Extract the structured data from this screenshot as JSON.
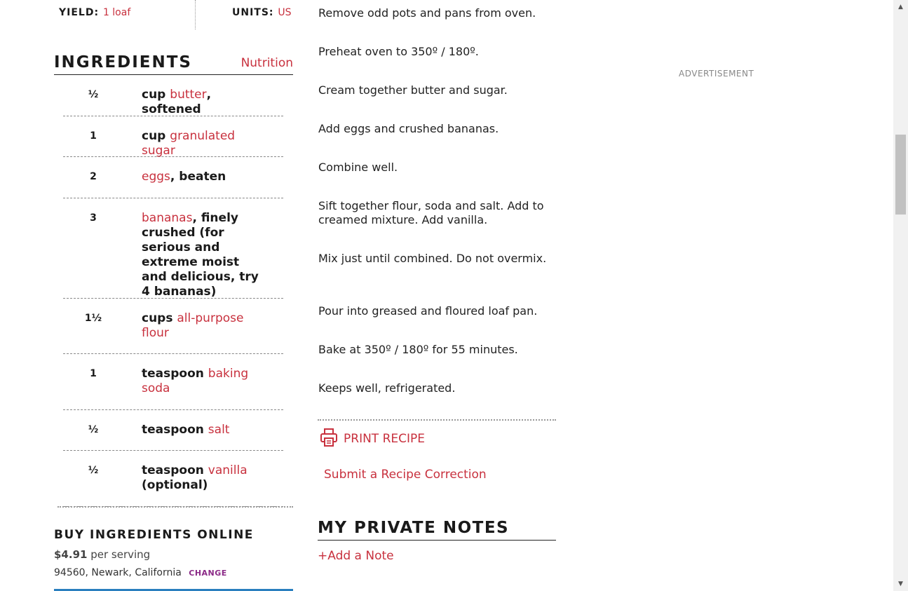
{
  "yield": {
    "label": "YIELD:",
    "value": "1 loaf"
  },
  "units": {
    "label": "UNITS:",
    "value": "US"
  },
  "ingredients": {
    "title": "INGREDIENTS",
    "nutrition_link": "Nutrition",
    "items": [
      {
        "qty": "½",
        "parts": [
          {
            "t": "cup "
          },
          {
            "t": "butter",
            "link": true
          },
          {
            "t": ", softened"
          }
        ]
      },
      {
        "qty": "1",
        "parts": [
          {
            "t": "cup "
          },
          {
            "t": "granulated sugar",
            "link": true
          }
        ]
      },
      {
        "qty": "2",
        "parts": [
          {
            "t": "eggs",
            "link": true
          },
          {
            "t": ", beaten"
          }
        ]
      },
      {
        "qty": "3",
        "parts": [
          {
            "t": "bananas",
            "link": true
          },
          {
            "t": ", finely crushed (for serious and extreme moist and delicious, try 4 bananas)"
          }
        ]
      },
      {
        "qty": "1½",
        "parts": [
          {
            "t": "cups "
          },
          {
            "t": "all-purpose flour",
            "link": true
          }
        ]
      },
      {
        "qty": "1",
        "parts": [
          {
            "t": "teaspoon "
          },
          {
            "t": "baking soda",
            "link": true
          }
        ]
      },
      {
        "qty": "½",
        "parts": [
          {
            "t": "teaspoon "
          },
          {
            "t": "salt",
            "link": true
          }
        ]
      },
      {
        "qty": "½",
        "parts": [
          {
            "t": "teaspoon "
          },
          {
            "t": "vanilla",
            "link": true
          },
          {
            "t": " (optional)"
          }
        ]
      }
    ]
  },
  "buy": {
    "title": "BUY INGREDIENTS ONLINE",
    "price": "$4.91",
    "per_serving": "per serving",
    "location": "94560, Newark, California",
    "change": "CHANGE"
  },
  "steps": [
    "Remove odd pots and pans from oven.",
    "Preheat oven to 350º / 180º.",
    "Cream together butter and sugar.",
    "Add eggs and crushed bananas.",
    "Combine well.",
    "Sift together flour, soda and salt. Add to creamed mixture. Add vanilla.",
    "Mix just until combined. Do not overmix.",
    "Pour into greased and floured loaf pan.",
    "Bake at 350º / 180º for 55 minutes.",
    "Keeps well, refrigerated."
  ],
  "actions": {
    "print_label": "PRINT RECIPE",
    "print_icon": "printer-icon",
    "correction_label": "Submit a Recipe Correction"
  },
  "notes": {
    "title": "MY PRIVATE NOTES",
    "add_label": "+Add a Note"
  },
  "ad_label": "ADVERTISEMENT",
  "colors": {
    "accent": "#c8313e",
    "change": "#8b2a87",
    "bar": "#2a7fbf"
  }
}
